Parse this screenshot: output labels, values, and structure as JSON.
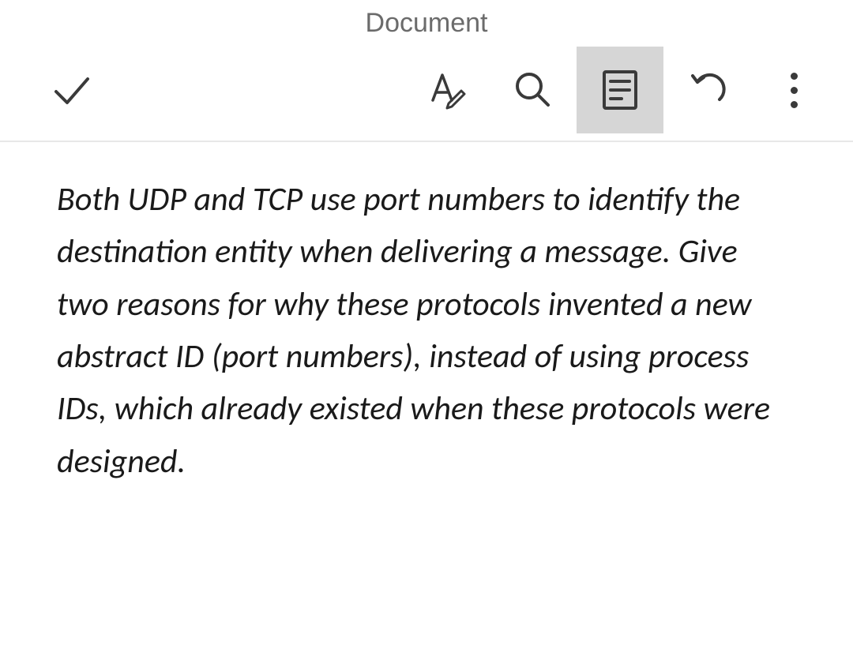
{
  "title": "Document",
  "toolbar": {
    "done_icon": "checkmark-icon",
    "edit_icon": "text-edit-icon",
    "search_icon": "search-icon",
    "layout_icon": "page-layout-icon",
    "undo_icon": "undo-icon",
    "more_icon": "more-vertical-icon"
  },
  "document": {
    "body": "Both UDP and TCP use port numbers to identify the destination entity when delivering a message. Give two reasons for why these protocols invented a new abstract ID (port numbers), instead of using process IDs, which already existed when these protocols were designed."
  }
}
